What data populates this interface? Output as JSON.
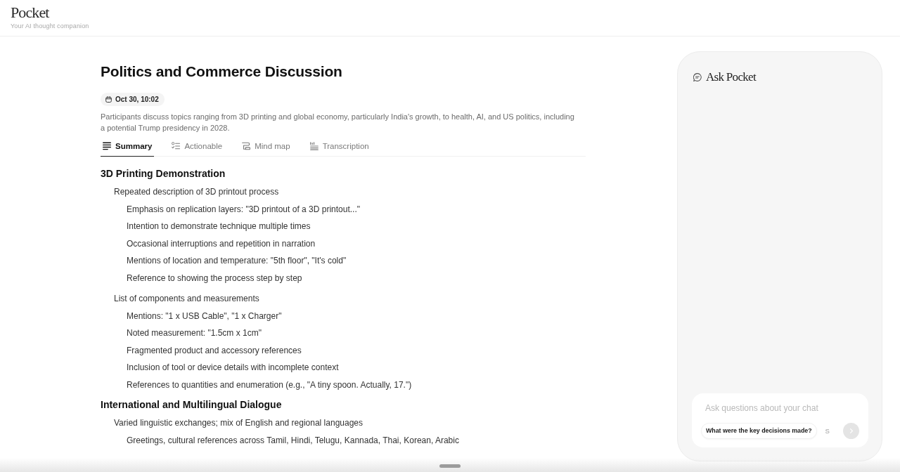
{
  "app": {
    "logo": "Pocket",
    "tagline": "Your AI thought companion"
  },
  "note": {
    "title": "Politics and Commerce Discussion",
    "date": "Oct 30, 10:02",
    "description": "Participants discuss topics ranging from 3D printing and global economy, particularly India's growth, to health, AI, and US politics, including a potential Trump presidency in 2028.",
    "tabs": [
      {
        "label": "Summary",
        "selected": true
      },
      {
        "label": "Actionable",
        "selected": false
      },
      {
        "label": "Mind map",
        "selected": false
      },
      {
        "label": "Transcription",
        "selected": false
      }
    ],
    "summary": [
      {
        "text": "3D Printing Demonstration",
        "children": [
          {
            "text": "Repeated description of 3D printout process",
            "children": [
              {
                "text": "Emphasis on replication layers: \"3D printout of a 3D printout...\""
              },
              {
                "text": "Intention to demonstrate technique multiple times"
              },
              {
                "text": "Occasional interruptions and repetition in narration"
              },
              {
                "text": "Mentions of location and temperature: \"5th floor\", \"It's cold\""
              },
              {
                "text": "Reference to showing the process step by step"
              }
            ]
          },
          {
            "text": "List of components and measurements",
            "children": [
              {
                "text": "Mentions: \"1 x USB Cable\", \"1 x Charger\""
              },
              {
                "text": "Noted measurement: \"1.5cm x 1cm\""
              },
              {
                "text": "Fragmented product and accessory references"
              },
              {
                "text": "Inclusion of tool or device details with incomplete context"
              },
              {
                "text": "References to quantities and enumeration (e.g., \"A tiny spoon. Actually, 17.\")"
              }
            ]
          }
        ]
      },
      {
        "text": "International and Multilingual Dialogue",
        "children": [
          {
            "text": "Varied linguistic exchanges; mix of English and regional languages",
            "children": [
              {
                "text": "Greetings, cultural references across Tamil, Hindi, Telugu, Kannada, Thai, Korean, Arabic"
              }
            ]
          }
        ]
      }
    ]
  },
  "ask_panel": {
    "title": "Ask Pocket",
    "input": {
      "placeholder": "Ask questions about your chat"
    },
    "suggestions": [
      {
        "text": "What were the key decisions made?",
        "faded": false
      },
      {
        "text": "S",
        "faded": true
      }
    ]
  }
}
